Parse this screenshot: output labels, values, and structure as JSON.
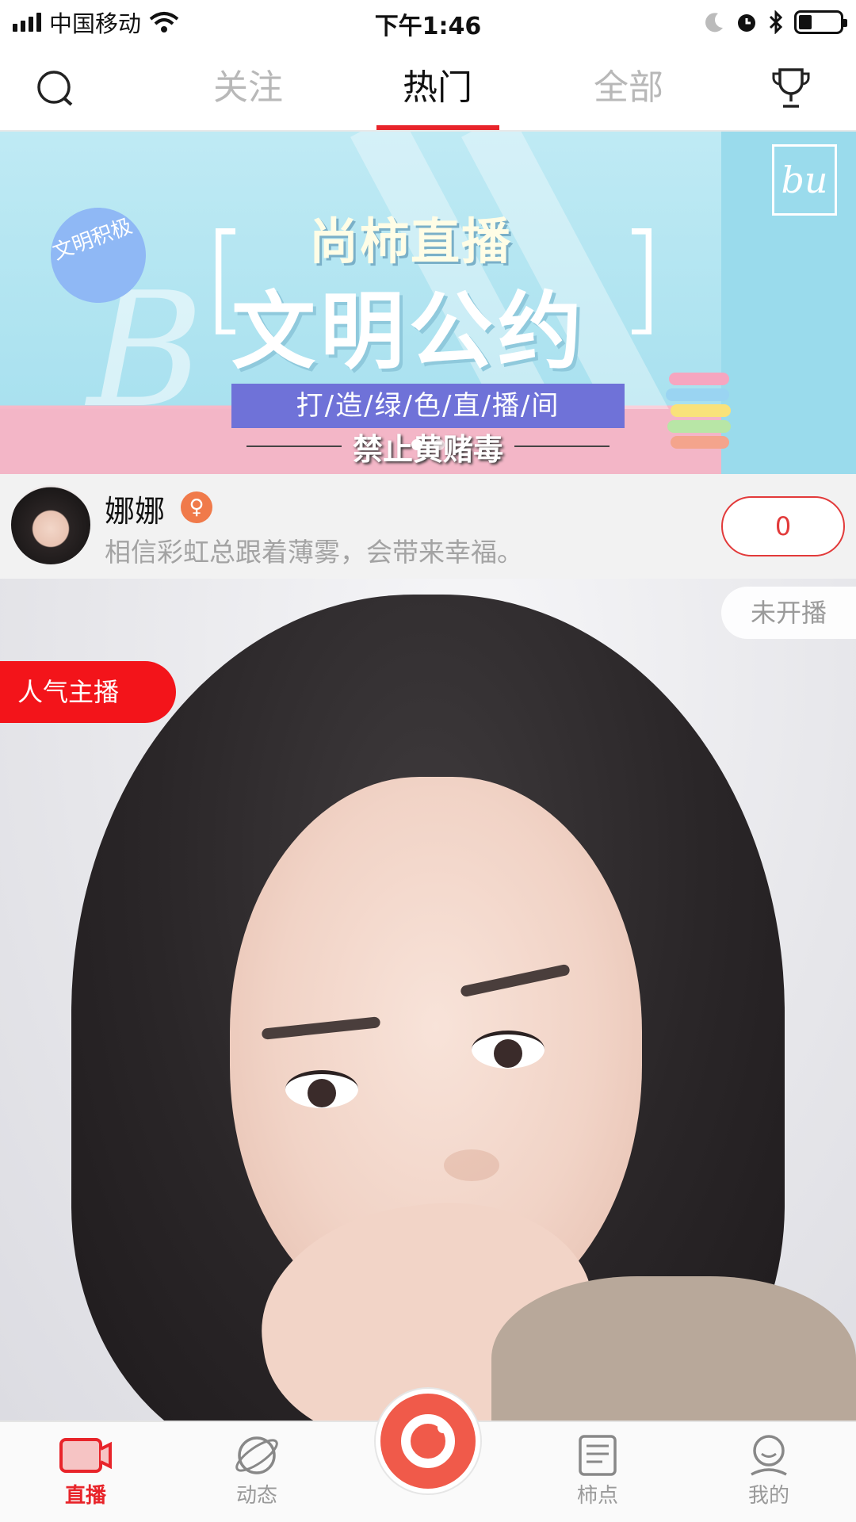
{
  "status_bar": {
    "carrier": "中国移动",
    "time": "下午1:46"
  },
  "nav": {
    "tabs": [
      {
        "label": "关注",
        "active": false
      },
      {
        "label": "热门",
        "active": true
      },
      {
        "label": "全部",
        "active": false
      }
    ],
    "left_icon": "search-icon",
    "right_icon": "trophy-icon",
    "accent_color": "#e8242a"
  },
  "banner": {
    "badge": "文明积极",
    "title": "尚柿直播",
    "main": "文明公约",
    "strip": "打/造/绿/色/直/播/间",
    "footer": "禁止黄赌毒",
    "logo": "bu",
    "script_text": "B"
  },
  "anchor": {
    "name": "娜娜",
    "gender_icon": "female-icon",
    "signature": "相信彩虹总跟着薄雾，会带来幸福。",
    "count": "0"
  },
  "cover": {
    "popular_tag": "人气主播",
    "status_tag": "未开播"
  },
  "bottom_nav": {
    "items": [
      {
        "label": "直播",
        "icon": "live-camera-icon",
        "active": true
      },
      {
        "label": "动态",
        "icon": "planet-icon",
        "active": false
      },
      {
        "label": "柿点",
        "icon": "document-icon",
        "active": false
      },
      {
        "label": "我的",
        "icon": "profile-icon",
        "active": false
      }
    ],
    "center_icon": "record-icon"
  }
}
